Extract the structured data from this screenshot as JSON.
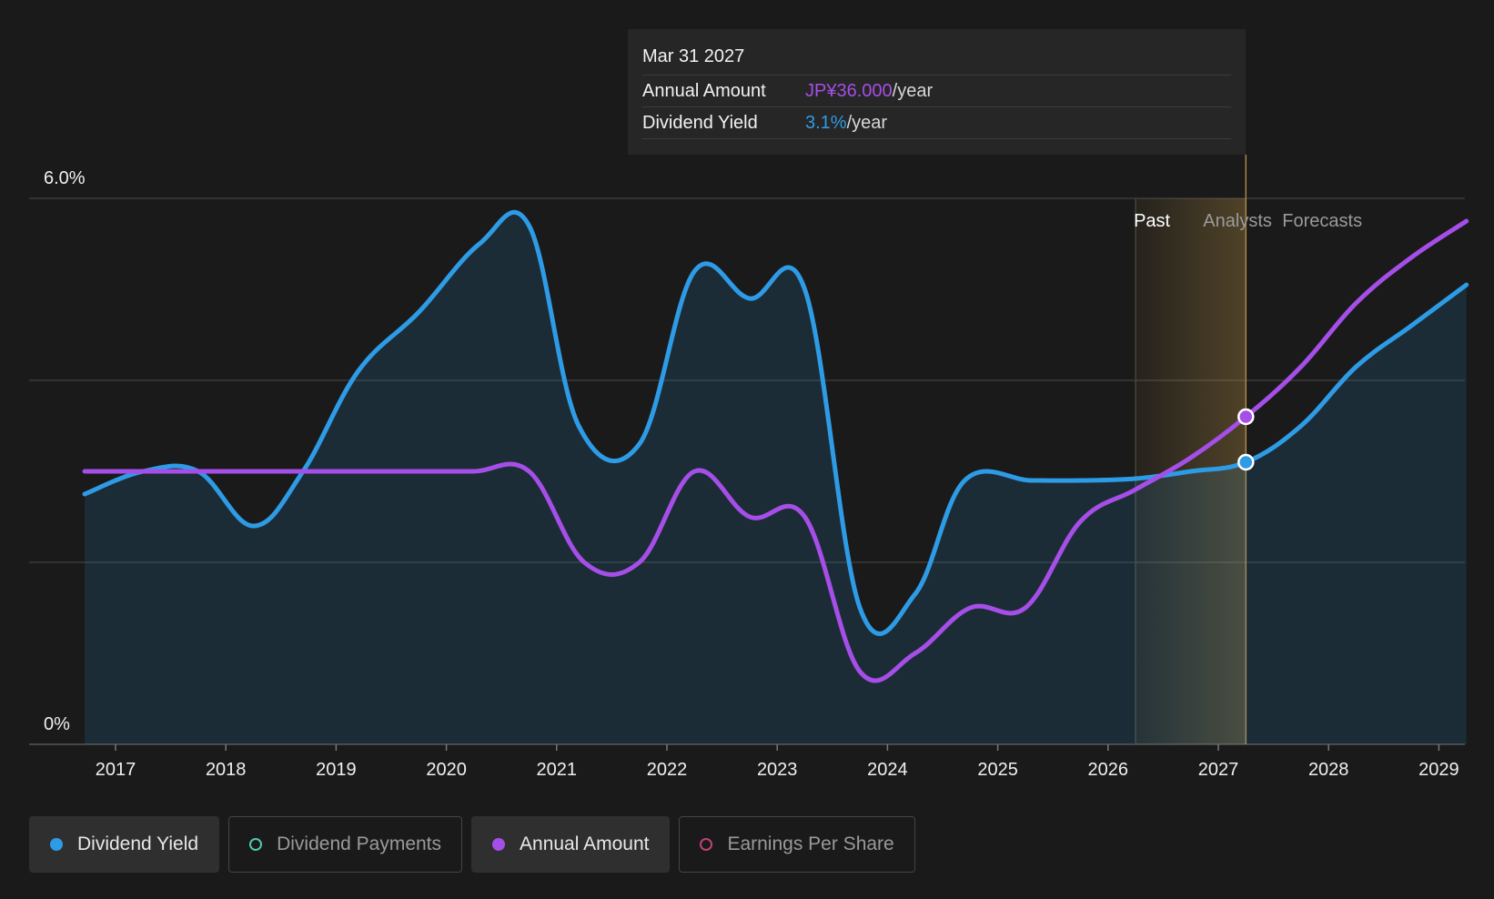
{
  "tooltip": {
    "date": "Mar 31 2027",
    "rows": [
      {
        "label": "Annual Amount",
        "value": "JP¥36.000",
        "unit": "/year"
      },
      {
        "label": "Dividend Yield",
        "value": "3.1%",
        "unit": "/year"
      }
    ]
  },
  "legend": [
    {
      "label": "Dividend Yield",
      "color": "#2e9be6",
      "state": "active",
      "marker": "filled"
    },
    {
      "label": "Dividend Payments",
      "color": "#4fc9b0",
      "state": "inactive",
      "marker": "hollow"
    },
    {
      "label": "Annual Amount",
      "color": "#a54ee8",
      "state": "active",
      "marker": "filled"
    },
    {
      "label": "Earnings Per Share",
      "color": "#c2407a",
      "state": "inactive",
      "marker": "hollow"
    }
  ],
  "colors": {
    "yield": "#2e9be6",
    "annual": "#a54ee8",
    "forecast_band": "#d9a84a",
    "grid": "#3a3a3a",
    "background": "#1a1a1a"
  },
  "chart_data": {
    "type": "line",
    "y_axis": {
      "min": 0,
      "max": 6.0,
      "tick_labels": [
        "6.0%",
        "0%"
      ],
      "gridlines": [
        0,
        2,
        4,
        6
      ]
    },
    "x_axis": {
      "min": 2016.75,
      "max": 2029.25,
      "tick_labels": [
        "2017",
        "2018",
        "2019",
        "2020",
        "2021",
        "2022",
        "2023",
        "2024",
        "2025",
        "2026",
        "2027",
        "2028",
        "2029"
      ]
    },
    "regions": {
      "past_label": "Past",
      "forecast_label_1": "Analysts",
      "forecast_label_2": "Forecasts",
      "past_end": 2026.25,
      "highlight_date": 2027.25
    },
    "series": [
      {
        "name": "Dividend Yield",
        "key": "yield",
        "x": [
          2016.72,
          2017.25,
          2017.75,
          2018.25,
          2018.7,
          2019.2,
          2019.75,
          2020.3,
          2020.75,
          2021.2,
          2021.75,
          2022.25,
          2022.75,
          2023.25,
          2023.75,
          2024.25,
          2024.7,
          2025.3,
          2025.75,
          2026.25,
          2026.75,
          2027.25,
          2027.75,
          2028.25,
          2028.75,
          2029.25
        ],
        "y": [
          2.75,
          3.0,
          3.0,
          2.4,
          3.0,
          4.1,
          4.75,
          5.5,
          5.7,
          3.5,
          3.3,
          5.2,
          4.9,
          5.0,
          1.5,
          1.65,
          2.9,
          2.9,
          2.9,
          2.92,
          3.0,
          3.1,
          3.5,
          4.15,
          4.6,
          5.05
        ]
      },
      {
        "name": "Annual Amount",
        "key": "annual",
        "x": [
          2016.72,
          2017.25,
          2017.75,
          2018.25,
          2018.75,
          2019.25,
          2019.75,
          2020.25,
          2020.75,
          2021.25,
          2021.75,
          2022.25,
          2022.75,
          2023.25,
          2023.75,
          2024.25,
          2024.75,
          2025.25,
          2025.75,
          2026.25,
          2026.75,
          2027.25,
          2027.75,
          2028.25,
          2028.75,
          2029.25
        ],
        "y": [
          3.0,
          3.0,
          3.0,
          3.0,
          3.0,
          3.0,
          3.0,
          3.0,
          3.0,
          2.0,
          2.0,
          3.0,
          2.5,
          2.5,
          0.8,
          1.0,
          1.5,
          1.5,
          2.45,
          2.8,
          3.15,
          3.6,
          4.15,
          4.85,
          5.35,
          5.75
        ]
      }
    ],
    "highlight_values": {
      "yield": 3.1,
      "annual": 3.6
    }
  }
}
